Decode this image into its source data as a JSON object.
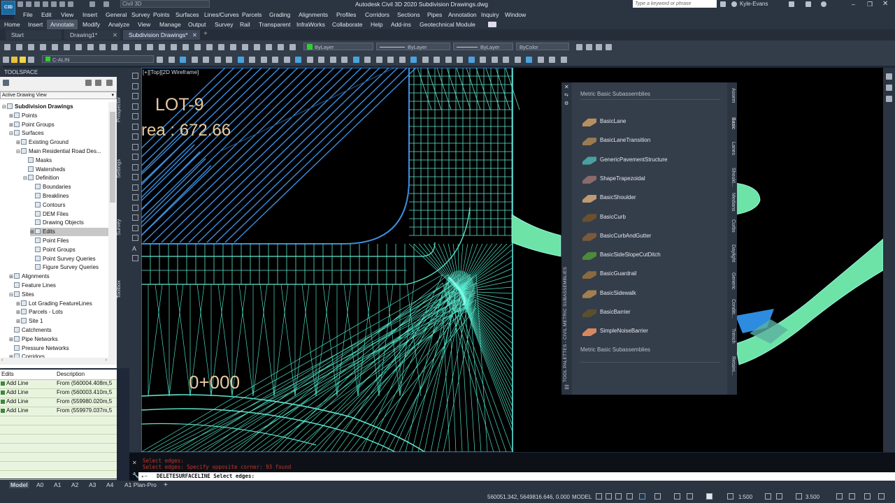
{
  "app": {
    "logo": "C3D",
    "workspace": "Civil 3D",
    "title": "Autodesk Civil 3D 2020    Subdivision Drawings.dwg",
    "search_placeholder": "Type a keyword or phrase",
    "user": "Kyle-Evans"
  },
  "menu": [
    "File",
    "Edit",
    "View",
    "Insert",
    "General",
    "Survey",
    "Points",
    "Surfaces",
    "Lines/Curves",
    "Parcels",
    "Grading",
    "Alignments",
    "Profiles",
    "Corridors",
    "Sections",
    "Pipes",
    "Annotation",
    "Inquiry",
    "Window"
  ],
  "ribbon_tabs": [
    "Home",
    "Insert",
    "Annotate",
    "Modify",
    "Analyze",
    "View",
    "Manage",
    "Output",
    "Survey",
    "Rail",
    "Transparent",
    "InfraWorks",
    "Collaborate",
    "Help",
    "Add-ins",
    "Geotechnical Module"
  ],
  "doc_tabs": [
    "Start",
    "Drawing1*",
    "Subdivision Drawings*"
  ],
  "properties": {
    "layer_combo": "C-ALIN",
    "color": "ByLayer",
    "linetype": "ByLayer",
    "lineweight": "ByLayer",
    "plotstyle": "ByColor"
  },
  "toolspace": {
    "title": "TOOLSPACE",
    "view": "Active Drawing View",
    "tree": [
      {
        "label": "Subdivision Drawings",
        "level": 0,
        "exp": "⊟",
        "bold": true
      },
      {
        "label": "Points",
        "level": 1,
        "exp": "⊞"
      },
      {
        "label": "Point Groups",
        "level": 1,
        "exp": "⊞"
      },
      {
        "label": "Surfaces",
        "level": 1,
        "exp": "⊟"
      },
      {
        "label": "Existing Ground",
        "level": 2,
        "exp": "⊞"
      },
      {
        "label": "Main Residential Road Des...",
        "level": 2,
        "exp": "⊟"
      },
      {
        "label": "Masks",
        "level": 3,
        "exp": ""
      },
      {
        "label": "Watersheds",
        "level": 3,
        "exp": ""
      },
      {
        "label": "Definition",
        "level": 3,
        "exp": "⊟"
      },
      {
        "label": "Boundaries",
        "level": 4,
        "exp": ""
      },
      {
        "label": "Breaklines",
        "level": 4,
        "exp": ""
      },
      {
        "label": "Contours",
        "level": 4,
        "exp": ""
      },
      {
        "label": "DEM Files",
        "level": 4,
        "exp": ""
      },
      {
        "label": "Drawing Objects",
        "level": 4,
        "exp": ""
      },
      {
        "label": "Edits",
        "level": 4,
        "exp": "⊞",
        "selected": true
      },
      {
        "label": "Point Files",
        "level": 4,
        "exp": ""
      },
      {
        "label": "Point Groups",
        "level": 4,
        "exp": ""
      },
      {
        "label": "Point Survey Queries",
        "level": 4,
        "exp": ""
      },
      {
        "label": "Figure Survey Queries",
        "level": 4,
        "exp": ""
      },
      {
        "label": "Alignments",
        "level": 1,
        "exp": "⊞"
      },
      {
        "label": "Feature Lines",
        "level": 1,
        "exp": ""
      },
      {
        "label": "Sites",
        "level": 1,
        "exp": "⊟"
      },
      {
        "label": "Lot Grading FeatureLines",
        "level": 2,
        "exp": "⊞"
      },
      {
        "label": "Parcels - Lots",
        "level": 2,
        "exp": "⊞"
      },
      {
        "label": "Site 1",
        "level": 2,
        "exp": "⊞"
      },
      {
        "label": "Catchments",
        "level": 1,
        "exp": ""
      },
      {
        "label": "Pipe Networks",
        "level": 1,
        "exp": "⊞"
      },
      {
        "label": "Pressure Networks",
        "level": 1,
        "exp": ""
      },
      {
        "label": "Corridors",
        "level": 1,
        "exp": "⊞"
      }
    ],
    "side_tabs": [
      "Prospector",
      "Settings",
      "Survey",
      "Toolbox"
    ]
  },
  "edits": {
    "columns": [
      "Edits",
      "Description"
    ],
    "rows": [
      {
        "op": "Add Line",
        "desc": "From (560004.408m,5"
      },
      {
        "op": "Add Line",
        "desc": "From (560003.410m,5"
      },
      {
        "op": "Add Line",
        "desc": "From (559980.020m,5"
      },
      {
        "op": "Add Line",
        "desc": "From (559979.037m,5"
      }
    ]
  },
  "viewport": {
    "label": "[+][Top][2D Wireframe]",
    "lot": "LOT-9",
    "area": "rea : 672.66",
    "station": "0+000"
  },
  "palette": {
    "title": "TOOL PALETTES - CIVIL METRIC SUBASSEMBLIES",
    "section": "Metric Basic Subassemblies",
    "footer": "Metric Basic Subassemblies",
    "items": [
      "BasicLane",
      "BasicLaneTransition",
      "GenericPavementStructure",
      "ShapeTrapezoidal",
      "BasicShoulder",
      "BasicCurb",
      "BasicCurbAndGutter",
      "BasicSideSlopeCutDitch",
      "BasicGuardrail",
      "BasicSidewalk",
      "BasicBarrier",
      "SimpleNoiseBarrier"
    ],
    "item_colors": [
      "#b89060",
      "#9c7a52",
      "#4aa0a0",
      "#8a6a6a",
      "#c09a70",
      "#6a5030",
      "#7a5a3a",
      "#4d8a3a",
      "#8a6a40",
      "#a08050",
      "#5a5030",
      "#d88860"
    ],
    "tabs": [
      "Assem",
      "Basic",
      "Lanes",
      "Should...",
      "Medians",
      "Curbs",
      "Daylight",
      "Generic",
      "Conditi...",
      "Trench",
      "Retaini..."
    ]
  },
  "command": {
    "history1": "Select edges:",
    "history2": "Select edges: Specify opposite corner: 93 found",
    "prompt": "DELETESURFACELINE Select edges:"
  },
  "layouts": [
    "Model",
    "A0",
    "A1",
    "A2",
    "A3",
    "A4",
    "A1 Plan-Pro"
  ],
  "status": {
    "coords": "560051.342, 5649816.646, 0.000",
    "mode": "MODEL",
    "scale": "1:500",
    "anno_scale": "3.500"
  }
}
